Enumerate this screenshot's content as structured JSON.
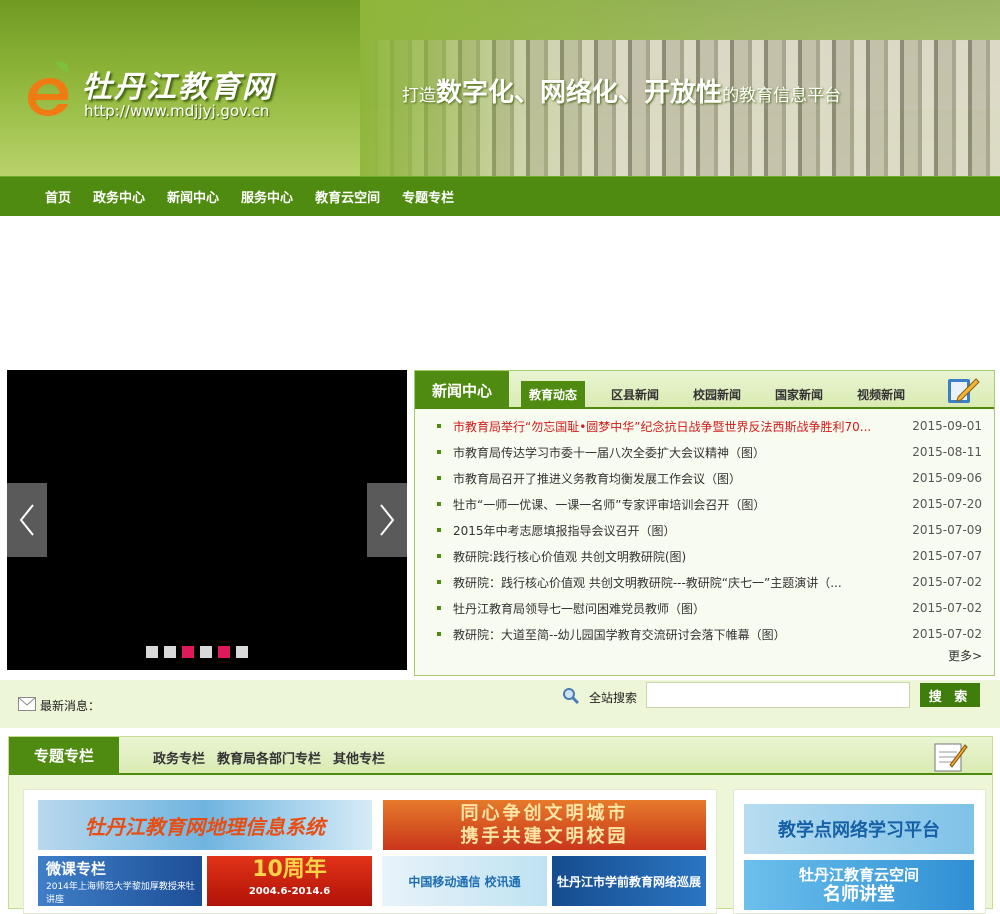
{
  "header": {
    "logo_cn": "牡丹江教育网",
    "logo_url": "http://www.mdjjyj.gov.cn",
    "slogan": {
      "prefix": "打造",
      "word1": "数字化",
      "sep1": "、",
      "word2": "网络化",
      "sep2": "、",
      "word3": "开放性",
      "suffix": "的教育信息平台"
    }
  },
  "nav": [
    "首页",
    "政务中心",
    "新闻中心",
    "服务中心",
    "教育云空间",
    "专题专栏"
  ],
  "slider": {
    "dots": 6,
    "active_dots": [
      2,
      4
    ],
    "colors": {
      "active": "#e0195a",
      "inactive": "#d9d9d9"
    }
  },
  "news": {
    "title": "新闻中心",
    "tabs": [
      "教育动态",
      "区县新闻",
      "校园新闻",
      "国家新闻",
      "视频新闻"
    ],
    "active_tab": 0,
    "items": [
      {
        "title": "市教育局举行“勿忘国耻•圆梦中华”纪念抗日战争暨世界反法西斯战争胜利70...",
        "date": "2015-09-01",
        "hot": true
      },
      {
        "title": "市教育局传达学习市委十一届八次全委扩大会议精神（图）",
        "date": "2015-08-11"
      },
      {
        "title": "市教育局召开了推进义务教育均衡发展工作会议（图）",
        "date": "2015-09-06"
      },
      {
        "title": "牡市“一师一优课、一课一名师”专家评审培训会召开（图）",
        "date": "2015-07-20"
      },
      {
        "title": "2015年中考志愿填报指导会议召开（图）",
        "date": "2015-07-09"
      },
      {
        "title": "教研院:践行核心价值观 共创文明教研院(图)",
        "date": "2015-07-07"
      },
      {
        "title": "教研院：践行核心价值观 共创文明教研院---教研院“庆七一”主题演讲（...",
        "date": "2015-07-02"
      },
      {
        "title": "牡丹江教育局领导七一慰问困难党员教师（图）",
        "date": "2015-07-02"
      },
      {
        "title": "教研院：大道至简--幼儿园国学教育交流研讨会落下帷幕（图）",
        "date": "2015-07-02"
      }
    ],
    "more": "更多>"
  },
  "strip": {
    "latest_label": "最新消息：",
    "search_label": "全站搜索",
    "search_value": "",
    "search_button": "搜 索"
  },
  "special": {
    "title": "专题专栏",
    "tabs": [
      "政务专栏",
      "教育局各部门专栏",
      "其他专栏"
    ],
    "banners": {
      "geo": "牡丹江教育网地理信息系统",
      "civ_line1": "同心争创文明城市",
      "civ_line2": "携手共建文明校园",
      "micro_title": "微课专栏",
      "micro_sub": "2014年上海师范大学黎加厚教授来牡讲座",
      "ten_title": "10周年",
      "ten_sub": "2004.6-2014.6",
      "mobile": "中国移动通信 校讯通",
      "preschool": "牡丹江市学前教育网络巡展",
      "net": "教学点网络学习平台",
      "cloud_line1": "牡丹江教育云空间",
      "cloud_line2": "名师讲堂"
    }
  },
  "colors": {
    "brand_green": "#4f8b10",
    "hot_red": "#d01a1a",
    "strip_bg": "#edf6d6"
  }
}
